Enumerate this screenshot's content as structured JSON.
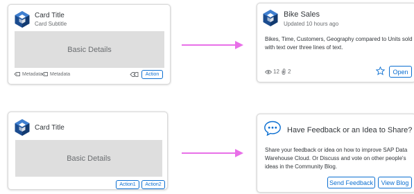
{
  "card1": {
    "title": "Card Title",
    "subtitle": "Card Subtitle",
    "content": "Basic Details",
    "metadata": [
      "Metadata",
      "Metadata"
    ],
    "action_label": "Action"
  },
  "card2": {
    "title": "Bike Sales",
    "subtitle": "Updated 10 hours ago",
    "text": "Bikes, Time, Customers, Geography compared to Units sold with text over three lines of text.",
    "views": "12",
    "attachments": "2",
    "open_label": "Open"
  },
  "card3": {
    "title": "Card Title",
    "content": "Basic Details",
    "action1_label": "Action1",
    "action2_label": "Action2"
  },
  "card4": {
    "title": "Have Feedback or an Idea to Share?",
    "text": "Share your feedback or idea on how to improve SAP Data Warehouse Cloud. Or Discuss and vote on other people's ideas in the Community Blog.",
    "send_feedback_label": "Send Feedback",
    "view_blog_label": "View Blog"
  },
  "colors": {
    "accent": "#0a6ed1",
    "arrow": "#e86fe8",
    "logo": "#1b4c8f"
  }
}
